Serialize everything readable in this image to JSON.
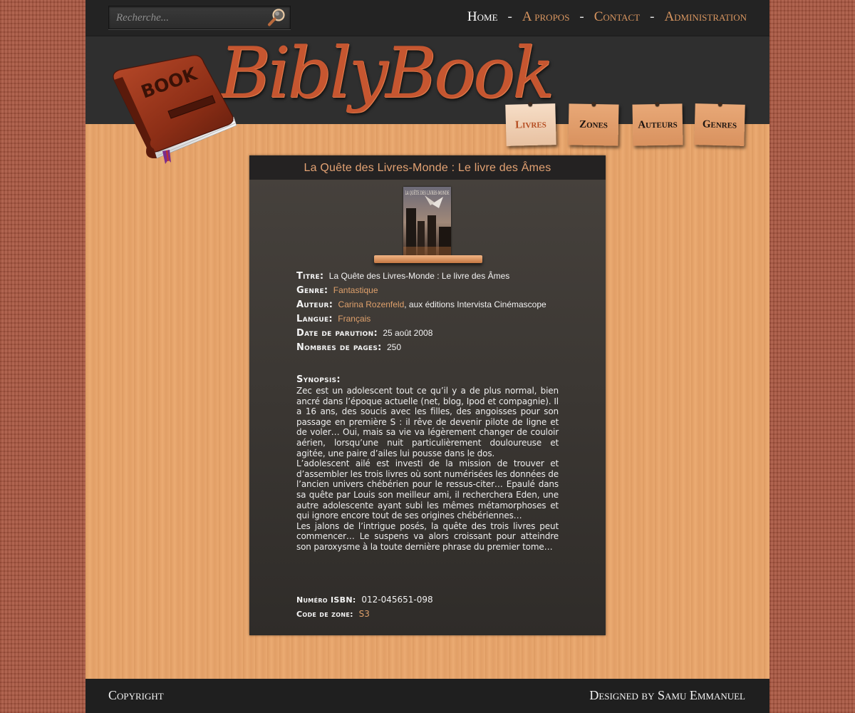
{
  "search": {
    "placeholder": "Recherche..."
  },
  "top_nav": [
    {
      "label": "Home"
    },
    {
      "label": "A propos"
    },
    {
      "label": "Contact"
    },
    {
      "label": "Administration"
    }
  ],
  "top_nav_separator": "-",
  "logo": {
    "text": "BiblyBook",
    "book_label": "BOOK"
  },
  "tabs": [
    {
      "label": "Livres"
    },
    {
      "label": "Zones"
    },
    {
      "label": "Auteurs"
    },
    {
      "label": "Genres"
    }
  ],
  "book": {
    "title_bar": "La Quête des Livres-Monde : Le livre des Âmes",
    "cover_text": "LA QUÊTE DES LIVRES-MONDE",
    "fields": {
      "titre_label": "Titre:",
      "titre": "La Quête des Livres-Monde : Le livre des Âmes",
      "genre_label": "Genre:",
      "genre": "Fantastique",
      "auteur_label": "Auteur:",
      "auteur": "Carina Rozenfeld",
      "editeur": ", aux éditions Intervista Cinémascope",
      "langue_label": "Langue:",
      "langue": "Français",
      "date_label": "Date de parution:",
      "date": "25 août 2008",
      "pages_label": "Nombres de pages:",
      "pages": "250"
    },
    "synopsis_label": "Synopsis:",
    "synopsis": [
      "Zec est un adolescent tout ce qu’il y a de plus normal, bien ancré dans l’époque actuelle (net, blog, Ipod et compagnie). Il a 16 ans, des soucis avec les filles, des angoisses pour son passage en première S : il rêve de devenir pilote de ligne et de voler… Oui, mais sa vie va légèrement changer de couloir aérien, lorsqu’une nuit particulièrement douloureuse et agitée, une paire d’ailes lui pousse dans le dos.",
      "L’adolescent ailé est investi de la mission de trouver et d’assembler les trois livres où sont numérisées les données de l’ancien univers chébérien pour le ressus-citer… Epaulé dans sa quête par Louis son meilleur ami, il recherchera Eden, une autre adolescente ayant subi les mêmes métamorphoses et qui ignore encore tout de ses origines chébériennes…",
      "Les jalons de l’intrigue posés, la quête des trois livres peut commencer… Le suspens va alors croissant pour atteindre son paroxysme à la toute dernière phrase du premier tome…"
    ],
    "isbn_label": "Numéro ISBN:",
    "isbn": "012-045651-098",
    "zone_label": "Code de zone:",
    "zone": "S3"
  },
  "footer": {
    "left": "Copyright",
    "right": "Designed by Samu Emmanuel"
  },
  "colors": {
    "accent": "#d99660",
    "logo": "#c65630",
    "topbar": "#232323",
    "content_bg": "#3a3633",
    "wood": "#e8a56c",
    "wall": "#a9553f"
  },
  "icons": {
    "search": "magnifier-icon",
    "logo": "book-icon"
  }
}
